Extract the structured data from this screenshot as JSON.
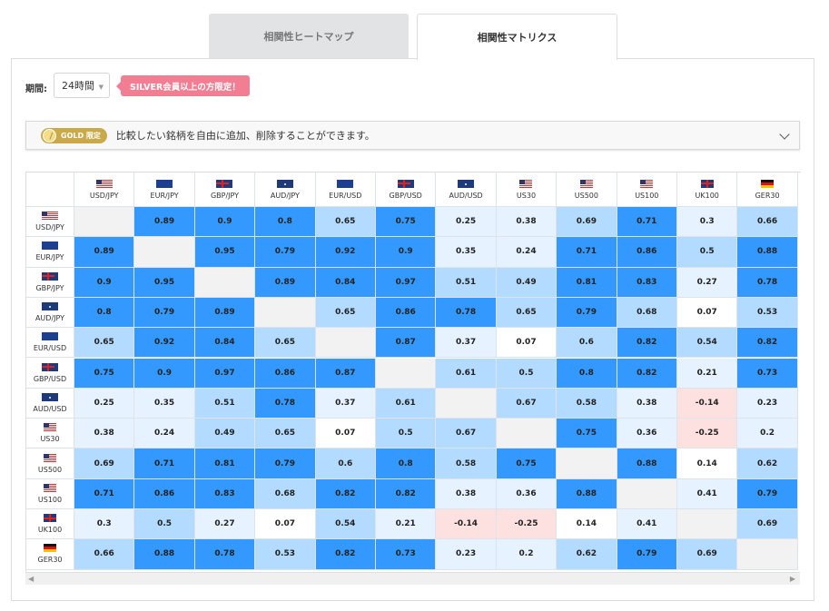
{
  "tabs": {
    "heatmap": "相関性ヒートマップ",
    "matrix": "相関性マトリクス"
  },
  "period": {
    "label": "期間:",
    "value": "24時間"
  },
  "silver_badge": "SILVER会員以上の方限定！",
  "gold_bar": {
    "badge": "GOLD 限定",
    "text": "比較したい銘柄を自由に追加、削除することができます。"
  },
  "colors": {
    "strong": "#3399ff",
    "medium": "#b3dbff",
    "weak": "#e6f2ff",
    "none": "#ffffff",
    "negative": "#fde0e0",
    "diagonal": "#f2f2f2"
  },
  "columns": [
    {
      "label": "USD/JPY",
      "flag": "us-jp"
    },
    {
      "label": "EUR/JPY",
      "flag": "eu-jp"
    },
    {
      "label": "GBP/JPY",
      "flag": "gb-jp"
    },
    {
      "label": "AUD/JPY",
      "flag": "au-jp"
    },
    {
      "label": "EUR/USD",
      "flag": "eu-us"
    },
    {
      "label": "GBP/USD",
      "flag": "gb-us"
    },
    {
      "label": "AUD/USD",
      "flag": "au-us"
    },
    {
      "label": "US30",
      "flag": "us"
    },
    {
      "label": "US500",
      "flag": "us"
    },
    {
      "label": "US100",
      "flag": "us"
    },
    {
      "label": "UK100",
      "flag": "gb"
    },
    {
      "label": "GER30",
      "flag": "de"
    }
  ],
  "matrix": [
    [
      null,
      "0.89",
      "0.9",
      "0.8",
      "0.65",
      "0.75",
      "0.25",
      "0.38",
      "0.69",
      "0.71",
      "0.3",
      "0.66"
    ],
    [
      "0.89",
      null,
      "0.95",
      "0.79",
      "0.92",
      "0.9",
      "0.35",
      "0.24",
      "0.71",
      "0.86",
      "0.5",
      "0.88"
    ],
    [
      "0.9",
      "0.95",
      null,
      "0.89",
      "0.84",
      "0.97",
      "0.51",
      "0.49",
      "0.81",
      "0.83",
      "0.27",
      "0.78"
    ],
    [
      "0.8",
      "0.79",
      "0.89",
      null,
      "0.65",
      "0.86",
      "0.78",
      "0.65",
      "0.79",
      "0.68",
      "0.07",
      "0.53"
    ],
    [
      "0.65",
      "0.92",
      "0.84",
      "0.65",
      null,
      "0.87",
      "0.37",
      "0.07",
      "0.6",
      "0.82",
      "0.54",
      "0.82"
    ],
    [
      "0.75",
      "0.9",
      "0.97",
      "0.86",
      "0.87",
      null,
      "0.61",
      "0.5",
      "0.8",
      "0.82",
      "0.21",
      "0.73"
    ],
    [
      "0.25",
      "0.35",
      "0.51",
      "0.78",
      "0.37",
      "0.61",
      null,
      "0.67",
      "0.58",
      "0.38",
      "-0.14",
      "0.23"
    ],
    [
      "0.38",
      "0.24",
      "0.49",
      "0.65",
      "0.07",
      "0.5",
      "0.67",
      null,
      "0.75",
      "0.36",
      "-0.25",
      "0.2"
    ],
    [
      "0.69",
      "0.71",
      "0.81",
      "0.79",
      "0.6",
      "0.8",
      "0.58",
      "0.75",
      null,
      "0.88",
      "0.14",
      "0.62"
    ],
    [
      "0.71",
      "0.86",
      "0.83",
      "0.68",
      "0.82",
      "0.82",
      "0.38",
      "0.36",
      "0.88",
      null,
      "0.41",
      "0.79"
    ],
    [
      "0.3",
      "0.5",
      "0.27",
      "0.07",
      "0.54",
      "0.21",
      "-0.14",
      "-0.25",
      "0.14",
      "0.41",
      null,
      "0.69"
    ],
    [
      "0.66",
      "0.88",
      "0.78",
      "0.53",
      "0.82",
      "0.73",
      "0.23",
      "0.2",
      "0.62",
      "0.79",
      "0.69",
      null
    ]
  ]
}
